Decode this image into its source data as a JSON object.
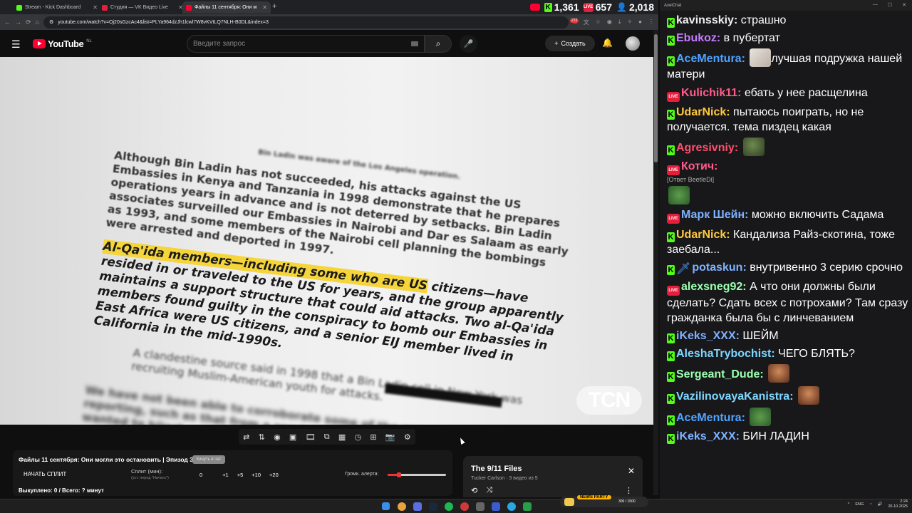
{
  "browser": {
    "tabs": [
      {
        "title": "Stream - Kick Dashboard",
        "favicon_color": "#53fc18",
        "active": false
      },
      {
        "title": "Студия — VK Видео Live",
        "favicon_color": "#e51e3b",
        "active": false
      },
      {
        "title": "Файлы 11 сентября: Они м",
        "favicon_color": "#ff0033",
        "active": true
      }
    ],
    "new_tab": "+",
    "url": "youtube.com/watch?v=Oj20sGzcAc4&list=PLYa964dzJh1lcwl7W8vKVtLQ7NLH-B0DL&index=3"
  },
  "stream_stats": {
    "kick_viewers": "1,361",
    "vk_viewers": "657",
    "yt_viewers": "2,018",
    "vk_badge": "LIVE"
  },
  "youtube": {
    "logo_text": "YouTube",
    "region": "NL",
    "search_placeholder": "Введите запрос",
    "create_label": "Создать",
    "notif_count": "272"
  },
  "video": {
    "paragraphs": [
      "Although Bin Ladin has not succeeded, his attacks against the US Embassies in Kenya and Tanzania in 1998 demonstrate that he prepares operations years in advance and is not deterred by setbacks. Bin Ladin associates surveilled our Embassies in Nairobi and Dar es Salaam as early as 1993, and some members of the Nairobi cell planning the bombings were arrested and deported in 1997."
    ],
    "highlight_text": "Al-Qa'ida members—including some who are US",
    "para2_rest": " citizens—have resided in or traveled to the US for years, and the group apparently maintains a support structure that could aid attacks. Two al-Qa'ida members found guilty in the conspiracy to bomb our Embassies in East Africa were US citizens, and a senior EIJ member lived in California in the mid-1990s.",
    "para3": "A clandestine source said in 1998 that a Bin Ladin cell in New York was recruiting Muslim-American youth for attacks.",
    "para4": "We have not been able to corroborate some of the more sensational threat reporting, such as that from a service in 1998 saying that Bin Ladin wanted to hijack a US aircraft to gain the release of \"Blind Shaykh\"",
    "top_fragment": "Bin Ladin was aware of the Los Angeles operation.",
    "watermark": "TCN"
  },
  "extension": {
    "title": "Файлы 11 сентября: Они могли это остановить | Эпизод 3",
    "chip": "Кинуть в чат",
    "start_split": "НАЧАТЬ СПЛИТ",
    "split_label": "Сплит (мин):",
    "split_hint": "(уст. перед \"Начать\")",
    "split_buttons": [
      "0",
      "+1",
      "+5",
      "+10",
      "+20"
    ],
    "volume_label": "Громк. алерта:",
    "volume_value": 0.2,
    "summary": "Выкуплено: 0 / Всего: ? минут"
  },
  "playlist": {
    "title": "The 9/11 Files",
    "meta": "Tucker Carlson · 3 видео из 5"
  },
  "chat": {
    "window_title": "AxelChat",
    "messages": [
      {
        "platform": "kick",
        "user": "kavinsskiy",
        "color": "#f0f0f0",
        "text": "страшно"
      },
      {
        "platform": "kick",
        "user": "Ebukoz",
        "color": "#c77dff",
        "text": "в пубертат"
      },
      {
        "platform": "kick",
        "user": "AceMentura",
        "color": "#4fa3ff",
        "text": "лучшая подружка нашей матери",
        "emote": "cat"
      },
      {
        "platform": "vk",
        "user": "Kulichik11",
        "color": "#ff5c8a",
        "text": "ебать у нее расщелина"
      },
      {
        "platform": "kick",
        "user": "UdarNick",
        "color": "#ffc940",
        "text": "пытаюсь поиграть, но не получается. тема пиздец какая"
      },
      {
        "platform": "kick",
        "user": "Agresivniy",
        "color": "#ff4f6d",
        "text": "",
        "emote": "frog"
      },
      {
        "platform": "vk",
        "user": "Котич",
        "color": "#ff5c8a",
        "text": "",
        "reply": "[Ответ BeetleDi]",
        "emote": "pepe"
      },
      {
        "platform": "vk",
        "user": "Марк Шейн",
        "color": "#7fb2ff",
        "text": "можно включить Садама"
      },
      {
        "platform": "kick",
        "user": "UdarNick",
        "color": "#ffc940",
        "text": "Кандализа Райз-скотина, тоже заебала..."
      },
      {
        "platform": "kick",
        "user": "potaskun",
        "color": "#7fb2ff",
        "text": "внутривенно 3 серию срочно",
        "extra_badge": "sword"
      },
      {
        "platform": "vk",
        "user": "alexsneg92",
        "color": "#9cffb0",
        "text": "А что они должны были сделать? Сдать всех с потрохами? Там сразу гражданка была бы с линчеванием"
      },
      {
        "platform": "kick",
        "user": "iKeks_XXX",
        "color": "#7fb2ff",
        "text": "ШЕЙМ"
      },
      {
        "platform": "kick",
        "user": "AleshaTrybochist",
        "color": "#7fd6ff",
        "text": "ЧЕГО БЛЯТЬ?"
      },
      {
        "platform": "kick",
        "user": "Sergeant_Dude",
        "color": "#9cffb0",
        "text": "",
        "emote": "man"
      },
      {
        "platform": "kick",
        "user": "VazilinovayaKanistra",
        "color": "#7fd6ff",
        "text": "",
        "emote": "man"
      },
      {
        "platform": "kick",
        "user": "AceMentura",
        "color": "#4fa3ff",
        "text": "",
        "emote": "pepe"
      },
      {
        "platform": "kick",
        "user": "iKeks_XXX",
        "color": "#7fb2ff",
        "text": "БИН ЛАДИН"
      }
    ]
  },
  "taskbar": {
    "news_party": "NEWS PARTY",
    "news_progress": "300 / 1500",
    "lang": "ENG",
    "time": "2:24",
    "date": "26.10.2025"
  }
}
